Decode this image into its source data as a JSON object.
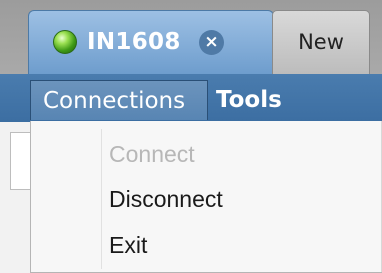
{
  "tabs": [
    {
      "label": "IN1608",
      "status": "connected",
      "status_color": "#3f9a16",
      "active": true,
      "close_glyph": "×"
    },
    {
      "label": "New",
      "active": false
    }
  ],
  "menubar": {
    "background_color": "#4577aa",
    "items": [
      {
        "label": "Connections",
        "open": true
      },
      {
        "label": "Tools",
        "open": false
      }
    ]
  },
  "dropdown": {
    "items": [
      {
        "label": "Connect",
        "enabled": false
      },
      {
        "label": "Disconnect",
        "enabled": true
      },
      {
        "label": "Exit",
        "enabled": true
      }
    ]
  }
}
